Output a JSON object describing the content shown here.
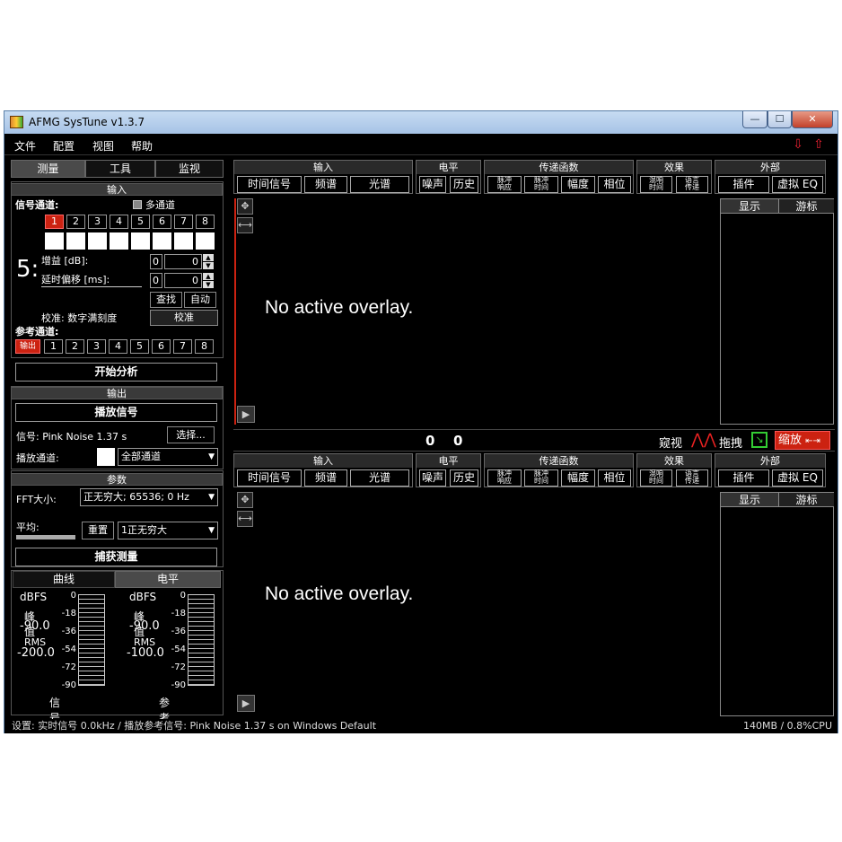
{
  "window": {
    "title": "AFMG SysTune v1.3.7",
    "btn_min": "—",
    "btn_max": "☐",
    "btn_close": "✕"
  },
  "menu": [
    "文件",
    "配置",
    "视图",
    "帮助"
  ],
  "left": {
    "tabs": [
      "测量",
      "工具",
      "监视"
    ],
    "input_section": "输入",
    "signal_channel_label": "信号通道:",
    "multi_channel_label": "多通道",
    "channels": [
      "1",
      "2",
      "3",
      "4",
      "5",
      "6",
      "7",
      "8"
    ],
    "big_number": "5:",
    "gain_label": "增益 [dB]:",
    "gain_value1": "0",
    "gain_value2": "0",
    "delay_label": "延时偏移 [ms]:",
    "delay_value1": "0",
    "delay_value2": "0",
    "find_btn": "查找",
    "auto_btn": "自动",
    "calib_label": "校准: 数字满刻度",
    "calib_btn": "校准",
    "ref_channel_label": "参考通道:",
    "ref_out": "输出",
    "start_btn": "开始分析",
    "output_section": "输出",
    "play_signal_btn": "播放信号",
    "signal_text": "信号: Pink Noise  1.37 s",
    "choose_btn": "选择...",
    "play_channel_label": "播放通道:",
    "play_channel_value": "全部通道",
    "params_section": "参数",
    "fft_label": "FFT大小:",
    "fft_value": "正无穷大; 65536; 0 Hz",
    "avg_label": "平均:",
    "reset_btn": "重置",
    "avg_value": "1正无穷大",
    "capture_btn": "捕获测量",
    "bottom_tabs": [
      "曲线",
      "电平"
    ],
    "meters": [
      {
        "unit": "dBFS",
        "peak_label": "峰值",
        "peak_value": "-90.0",
        "rms_label": "RMS",
        "rms_value": "-200.0",
        "name": "信号"
      },
      {
        "unit": "dBFS",
        "peak_label": "峰值",
        "peak_value": "-90.0",
        "rms_label": "RMS",
        "rms_value": "-100.0",
        "name": "参考"
      }
    ],
    "scale": [
      "0",
      "-18",
      "-36",
      "-54",
      "-72",
      "-90"
    ]
  },
  "pane": {
    "groups": {
      "input": {
        "title": "输入",
        "buttons": [
          "时间信号",
          "频谱",
          "光谱"
        ]
      },
      "level": {
        "title": "电平",
        "buttons": [
          "噪声",
          "历史"
        ]
      },
      "transfer": {
        "title": "传递函数",
        "buttons": [
          "脉冲\n响应",
          "脉冲\n时间",
          "幅度",
          "相位"
        ]
      },
      "effect": {
        "title": "效果",
        "buttons": [
          "混响\n时间",
          "语言\n传递"
        ]
      },
      "external": {
        "title": "外部",
        "buttons": [
          "插件",
          "虚拟 EQ"
        ]
      }
    },
    "overlay_text": "No active overlay.",
    "side_tabs": [
      "显示",
      "游标"
    ],
    "counter_left": "0",
    "counter_right": "0",
    "mode_view": "窥视",
    "mode_drag": "拖拽",
    "mode_zoom": "缩放"
  },
  "status": {
    "left": "设置: 实时信号  0.0kHz / 播放参考信号: Pink Noise  1.37 s on Windows Default",
    "right": "140MB / 0.8%CPU"
  },
  "colors": {
    "accent_red": "#cc2211",
    "background": "#000000"
  }
}
